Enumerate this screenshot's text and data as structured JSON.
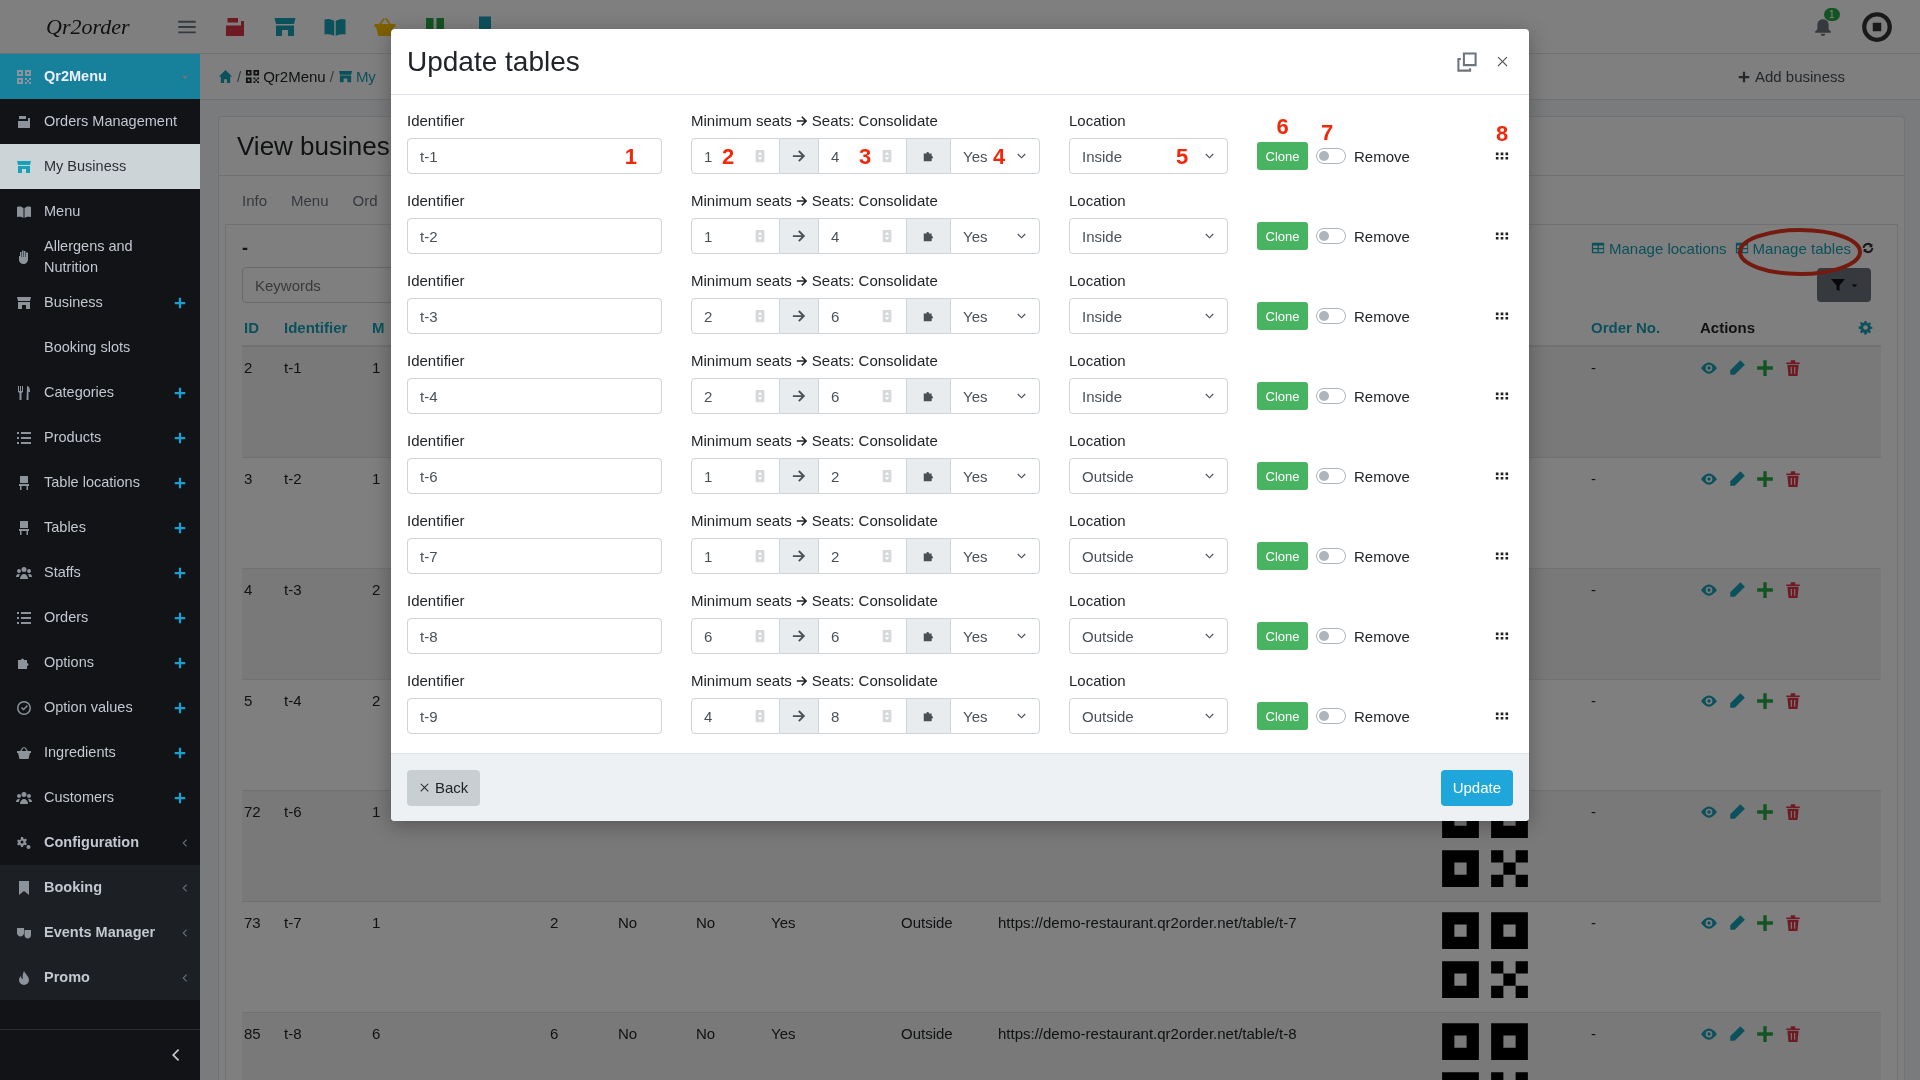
{
  "topbar": {
    "logo": "Qr2order",
    "notifications": "1"
  },
  "sidebar": {
    "items": [
      {
        "label": "Qr2Menu",
        "kind": "brand",
        "selected": false,
        "add": false
      },
      {
        "label": "Orders Management",
        "kind": "link",
        "selected": false,
        "add": false
      },
      {
        "label": "My Business",
        "kind": "link",
        "selected": true,
        "add": false
      },
      {
        "label": "Menu",
        "kind": "link",
        "selected": false,
        "add": false
      },
      {
        "label": "Allergens and Nutrition",
        "kind": "link",
        "selected": false,
        "add": false
      },
      {
        "label": "Business",
        "kind": "link",
        "selected": false,
        "add": true
      },
      {
        "label": "Booking slots",
        "kind": "link",
        "selected": false,
        "add": false
      },
      {
        "label": "Categories",
        "kind": "link",
        "selected": false,
        "add": true
      },
      {
        "label": "Products",
        "kind": "link",
        "selected": false,
        "add": true
      },
      {
        "label": "Table locations",
        "kind": "link",
        "selected": false,
        "add": true
      },
      {
        "label": "Tables",
        "kind": "link",
        "selected": false,
        "add": true
      },
      {
        "label": "Staffs",
        "kind": "link",
        "selected": false,
        "add": true
      },
      {
        "label": "Orders",
        "kind": "link",
        "selected": false,
        "add": true
      },
      {
        "label": "Options",
        "kind": "link",
        "selected": false,
        "add": true
      },
      {
        "label": "Option values",
        "kind": "link",
        "selected": false,
        "add": true
      },
      {
        "label": "Ingredients",
        "kind": "link",
        "selected": false,
        "add": true
      },
      {
        "label": "Customers",
        "kind": "link",
        "selected": false,
        "add": true
      },
      {
        "label": "Configuration",
        "kind": "group",
        "selected": false,
        "add": false
      },
      {
        "label": "Booking",
        "kind": "section",
        "selected": false,
        "add": false
      },
      {
        "label": "Events Manager",
        "kind": "section",
        "selected": false,
        "add": false
      },
      {
        "label": "Promo",
        "kind": "section",
        "selected": false,
        "add": false
      }
    ]
  },
  "breadcrumb": {
    "items": [
      {
        "separator": "/",
        "label": "Qr2Menu"
      },
      {
        "separator": "/",
        "label": "My"
      }
    ],
    "action": "Add business"
  },
  "card": {
    "title": "View busines",
    "tabs": [
      "Info",
      "Menu",
      "Ord"
    ],
    "heading": "-",
    "links": [
      "Manage locations",
      "Manage tables"
    ],
    "search": {
      "placeholder": "Keywords"
    },
    "table": {
      "header": {
        "id": "ID",
        "identifier": "Identifier",
        "column_3": "M",
        "order_no": "Order No.",
        "actions": "Actions"
      },
      "rows": [
        {
          "id": "2",
          "identifier": "t-1",
          "column_3": "1",
          "order_no": "-"
        },
        {
          "id": "3",
          "identifier": "t-2",
          "column_3": "1",
          "order_no": "-"
        },
        {
          "id": "4",
          "identifier": "t-3",
          "column_3": "2",
          "order_no": "-"
        },
        {
          "id": "5",
          "identifier": "t-4",
          "column_3": "2",
          "order_no": "-"
        },
        {
          "id": "72",
          "identifier": "t-6",
          "column_3": "1",
          "order_no": "-"
        },
        {
          "id": "73",
          "identifier": "t-7",
          "column_3": "1",
          "column_4": "2",
          "column_5": "No",
          "column_6": "No",
          "column_7": "Yes",
          "column_8": "Outside",
          "url": "https://demo-restaurant.qr2order.net/table/t-7",
          "order_no": "-"
        },
        {
          "id": "85",
          "identifier": "t-8",
          "column_3": "6",
          "column_4": "6",
          "column_5": "No",
          "column_6": "No",
          "column_7": "Yes",
          "column_8": "Outside",
          "url": "https://demo-restaurant.qr2order.net/table/t-8",
          "order_no": "-"
        }
      ]
    }
  },
  "modal": {
    "title": "Update tables",
    "rows": [
      {
        "identifier_label": "Identifier",
        "identifier": "t-1",
        "seats_label": "Minimum seats",
        "seats_label_2": "Seats: Consolidate",
        "min_seats": "1",
        "max_seats": "4",
        "consolidate": "Yes",
        "location_label": "Location",
        "location": "Inside",
        "clone": "Clone",
        "remove_label": "Remove",
        "remove": false,
        "callouts": {
          "identifier": "1",
          "min_seats": "2",
          "max_seats": "3",
          "consolidate": "4",
          "location": "5",
          "clone": "6",
          "remove": "7",
          "drag": "8"
        }
      },
      {
        "identifier_label": "Identifier",
        "identifier": "t-2",
        "seats_label": "Minimum seats",
        "seats_label_2": "Seats: Consolidate",
        "min_seats": "1",
        "max_seats": "4",
        "consolidate": "Yes",
        "location_label": "Location",
        "location": "Inside",
        "clone": "Clone",
        "remove_label": "Remove",
        "remove": false
      },
      {
        "identifier_label": "Identifier",
        "identifier": "t-3",
        "seats_label": "Minimum seats",
        "seats_label_2": "Seats: Consolidate",
        "min_seats": "2",
        "max_seats": "6",
        "consolidate": "Yes",
        "location_label": "Location",
        "location": "Inside",
        "clone": "Clone",
        "remove_label": "Remove",
        "remove": false
      },
      {
        "identifier_label": "Identifier",
        "identifier": "t-4",
        "seats_label": "Minimum seats",
        "seats_label_2": "Seats: Consolidate",
        "min_seats": "2",
        "max_seats": "6",
        "consolidate": "Yes",
        "location_label": "Location",
        "location": "Inside",
        "clone": "Clone",
        "remove_label": "Remove",
        "remove": false
      },
      {
        "identifier_label": "Identifier",
        "identifier": "t-6",
        "seats_label": "Minimum seats",
        "seats_label_2": "Seats: Consolidate",
        "min_seats": "1",
        "max_seats": "2",
        "consolidate": "Yes",
        "location_label": "Location",
        "location": "Outside",
        "clone": "Clone",
        "remove_label": "Remove",
        "remove": false
      },
      {
        "identifier_label": "Identifier",
        "identifier": "t-7",
        "seats_label": "Minimum seats",
        "seats_label_2": "Seats: Consolidate",
        "min_seats": "1",
        "max_seats": "2",
        "consolidate": "Yes",
        "location_label": "Location",
        "location": "Outside",
        "clone": "Clone",
        "remove_label": "Remove",
        "remove": false
      },
      {
        "identifier_label": "Identifier",
        "identifier": "t-8",
        "seats_label": "Minimum seats",
        "seats_label_2": "Seats: Consolidate",
        "min_seats": "6",
        "max_seats": "6",
        "consolidate": "Yes",
        "location_label": "Location",
        "location": "Outside",
        "clone": "Clone",
        "remove_label": "Remove",
        "remove": false
      },
      {
        "identifier_label": "Identifier",
        "identifier": "t-9",
        "seats_label": "Minimum seats",
        "seats_label_2": "Seats: Consolidate",
        "min_seats": "4",
        "max_seats": "8",
        "consolidate": "Yes",
        "location_label": "Location",
        "location": "Outside",
        "clone": "Clone",
        "remove_label": "Remove",
        "remove": false
      }
    ],
    "back": "Back",
    "update": "Update"
  }
}
